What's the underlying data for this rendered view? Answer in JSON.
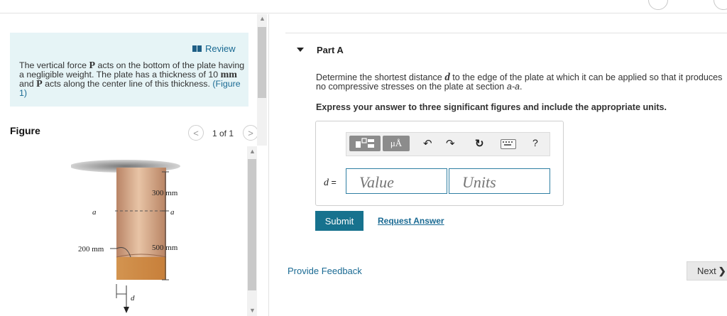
{
  "problem": {
    "review_label": "Review",
    "text_1": "The vertical force ",
    "force_symbol": "P",
    "text_2": " acts on the bottom of the plate having a negligible weight. The plate has a thickness of 10 ",
    "unit_mm": "mm",
    "text_3": " and ",
    "force_symbol_2": "P",
    "text_4": " acts along the center line of this thickness. ",
    "figure_link": "(Figure 1)"
  },
  "figure": {
    "title": "Figure",
    "pager": "1 of 1",
    "labels": {
      "dim_top": "300 mm",
      "dim_bottom": "500 mm",
      "dim_width": "200 mm",
      "section_left": "a",
      "section_right": "a",
      "distance": "d"
    }
  },
  "part": {
    "label": "Part A",
    "question_1": "Determine the shortest distance ",
    "question_var": "d",
    "question_2": " to the edge of the plate at which it can be applied so that it produces",
    "question_3": "no compressive stresses on the plate at section ",
    "question_section": "a-a",
    "question_4": ".",
    "instruction": "Express your answer to three significant figures and include the appropriate units."
  },
  "answer": {
    "var_label": "d",
    "equals": " =",
    "value_placeholder": "Value",
    "units_placeholder": "Units",
    "toolbar_mu": "μÅ",
    "toolbar_help": "?"
  },
  "actions": {
    "submit": "Submit",
    "request_answer": "Request Answer",
    "feedback": "Provide Feedback",
    "next": "Next"
  },
  "icons": [
    "book-icon",
    "chevron-left-icon",
    "chevron-right-icon",
    "templates-icon",
    "units-icon",
    "undo-icon",
    "redo-icon",
    "reset-icon",
    "keyboard-icon",
    "help-icon",
    "caret-down-icon"
  ],
  "colors": {
    "accent": "#17728e",
    "link": "#1a6a93",
    "problem_bg": "#e6f4f6",
    "input_border": "#2f7fa3"
  }
}
